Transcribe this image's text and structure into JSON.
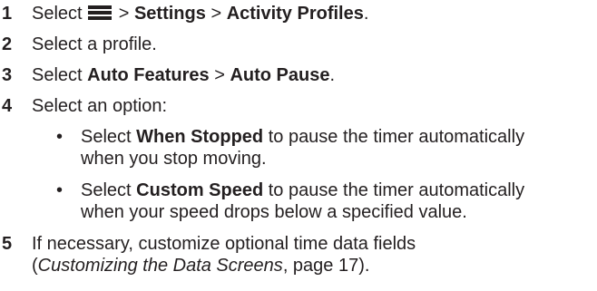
{
  "steps": [
    {
      "num": "1",
      "t1": "Select",
      "sep1": ">",
      "settings": "Settings",
      "sep2": ">",
      "profiles": "Activity Profiles",
      "end": ".",
      "icon": "menu-icon"
    },
    {
      "num": "2",
      "text": "Select a profile."
    },
    {
      "num": "3",
      "t1": "Select",
      "auto_features": "Auto Features",
      "sep": ">",
      "auto_pause": "Auto Pause",
      "end": "."
    },
    {
      "num": "4",
      "text": "Select an option:"
    },
    {
      "num": "5",
      "line1": "If necessary, customize optional time data fields",
      "open": "(",
      "link": "Customizing the Data Screens",
      "tail": ", page 17)."
    }
  ],
  "options": [
    {
      "bullet": "•",
      "t1": "Select",
      "name": "When Stopped",
      "t2": "to pause the timer automatically",
      "line2": "when you stop moving."
    },
    {
      "bullet": "•",
      "t1": "Select",
      "name": "Custom Speed",
      "t2": "to pause the timer automatically",
      "line2": "when your speed drops below a specified value."
    }
  ]
}
